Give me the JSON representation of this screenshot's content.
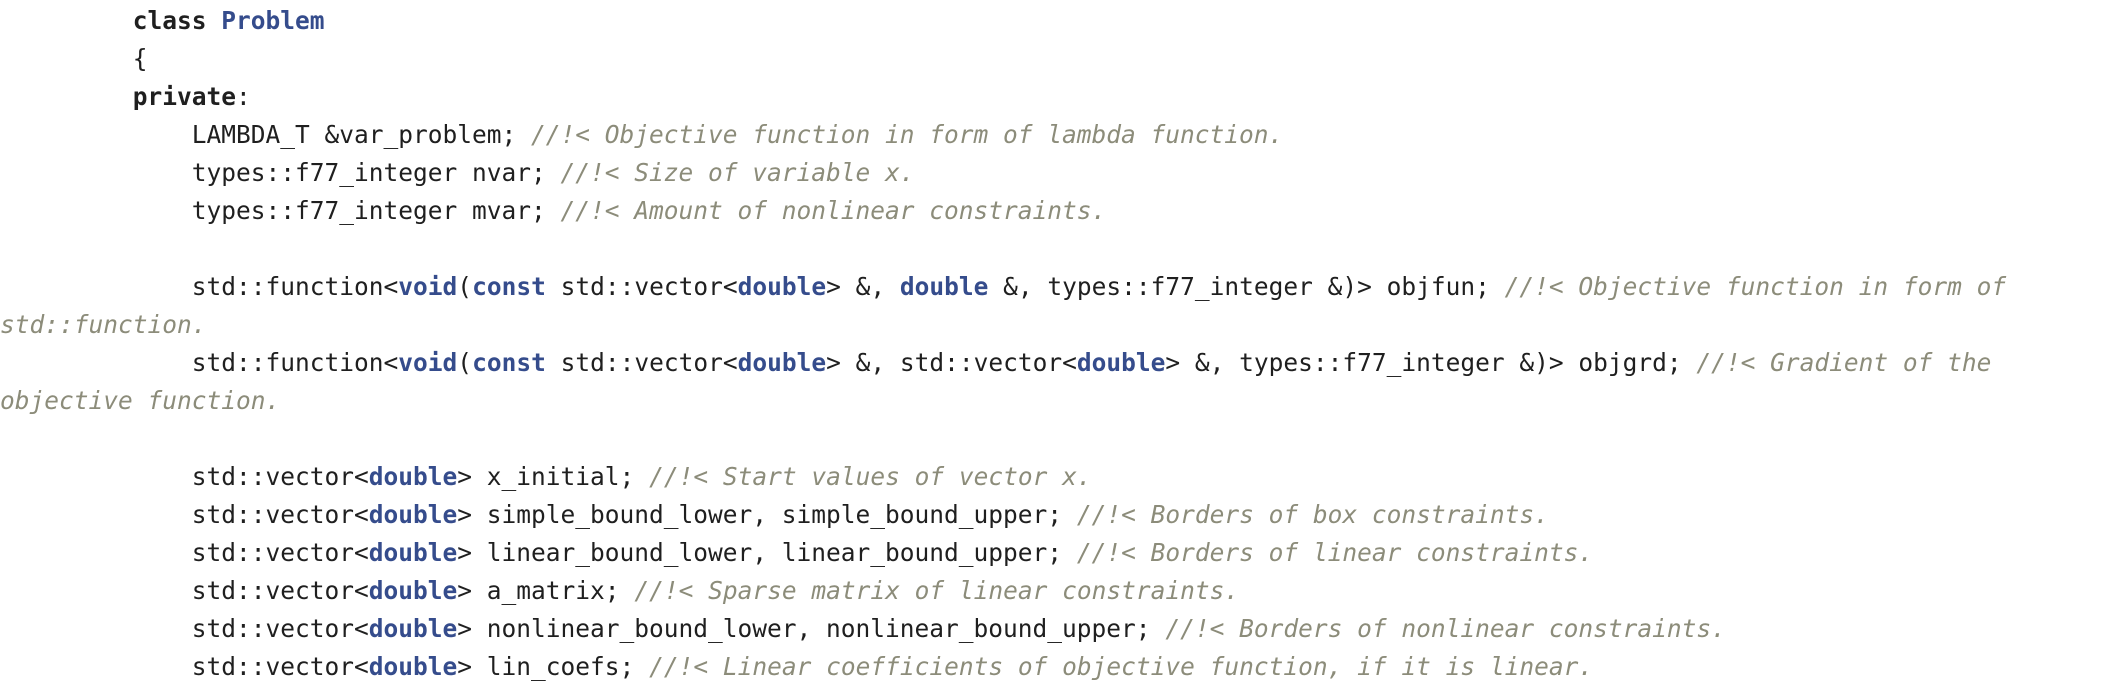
{
  "colors": {
    "background": "#ffffff",
    "text": "#1f1f1f",
    "keyword": "#1f1f1f",
    "type_keyword": "#354c8c",
    "comment": "#8c8c7a"
  },
  "code": {
    "lines": [
      {
        "indent": "         ",
        "tokens": [
          {
            "t": "class ",
            "c": "kw"
          },
          {
            "t": "Problem",
            "c": "tp"
          }
        ]
      },
      {
        "indent": "         ",
        "tokens": [
          {
            "t": "{",
            "c": "tx"
          }
        ]
      },
      {
        "indent": "         ",
        "tokens": [
          {
            "t": "private",
            "c": "kw"
          },
          {
            "t": ":",
            "c": "tx"
          }
        ]
      },
      {
        "indent": "             ",
        "tokens": [
          {
            "t": "LAMBDA_T &var_problem; ",
            "c": "tx"
          },
          {
            "t": "//!< Objective function in form of lambda function.",
            "c": "cm"
          }
        ]
      },
      {
        "indent": "             ",
        "tokens": [
          {
            "t": "types::f77_integer nvar; ",
            "c": "tx"
          },
          {
            "t": "//!< Size of variable x.",
            "c": "cm"
          }
        ]
      },
      {
        "indent": "             ",
        "tokens": [
          {
            "t": "types::f77_integer mvar; ",
            "c": "tx"
          },
          {
            "t": "//!< Amount of nonlinear constraints.",
            "c": "cm"
          }
        ]
      },
      {
        "indent": "",
        "tokens": []
      },
      {
        "indent": "             ",
        "tokens": [
          {
            "t": "std::function<",
            "c": "tx"
          },
          {
            "t": "void",
            "c": "tp"
          },
          {
            "t": "(",
            "c": "tx"
          },
          {
            "t": "const",
            "c": "tp"
          },
          {
            "t": " std::vector<",
            "c": "tx"
          },
          {
            "t": "double",
            "c": "tp"
          },
          {
            "t": "> &, ",
            "c": "tx"
          },
          {
            "t": "double",
            "c": "tp"
          },
          {
            "t": " &, types::f77_integer &)> objfun; ",
            "c": "tx"
          },
          {
            "t": "//!< Objective function in form of",
            "c": "cm"
          }
        ]
      },
      {
        "indent": "",
        "tokens": [
          {
            "t": "std::function.",
            "c": "cm"
          }
        ]
      },
      {
        "indent": "             ",
        "tokens": [
          {
            "t": "std::function<",
            "c": "tx"
          },
          {
            "t": "void",
            "c": "tp"
          },
          {
            "t": "(",
            "c": "tx"
          },
          {
            "t": "const",
            "c": "tp"
          },
          {
            "t": " std::vector<",
            "c": "tx"
          },
          {
            "t": "double",
            "c": "tp"
          },
          {
            "t": "> &, std::vector<",
            "c": "tx"
          },
          {
            "t": "double",
            "c": "tp"
          },
          {
            "t": "> &, types::f77_integer &)> objgrd; ",
            "c": "tx"
          },
          {
            "t": "//!< Gradient of the",
            "c": "cm"
          }
        ]
      },
      {
        "indent": "",
        "tokens": [
          {
            "t": "objective function.",
            "c": "cm"
          }
        ]
      },
      {
        "indent": "",
        "tokens": []
      },
      {
        "indent": "             ",
        "tokens": [
          {
            "t": "std::vector<",
            "c": "tx"
          },
          {
            "t": "double",
            "c": "tp"
          },
          {
            "t": "> x_initial; ",
            "c": "tx"
          },
          {
            "t": "//!< Start values of vector x.",
            "c": "cm"
          }
        ]
      },
      {
        "indent": "             ",
        "tokens": [
          {
            "t": "std::vector<",
            "c": "tx"
          },
          {
            "t": "double",
            "c": "tp"
          },
          {
            "t": "> simple_bound_lower, simple_bound_upper; ",
            "c": "tx"
          },
          {
            "t": "//!< Borders of box constraints.",
            "c": "cm"
          }
        ]
      },
      {
        "indent": "             ",
        "tokens": [
          {
            "t": "std::vector<",
            "c": "tx"
          },
          {
            "t": "double",
            "c": "tp"
          },
          {
            "t": "> linear_bound_lower, linear_bound_upper; ",
            "c": "tx"
          },
          {
            "t": "//!< Borders of linear constraints.",
            "c": "cm"
          }
        ]
      },
      {
        "indent": "             ",
        "tokens": [
          {
            "t": "std::vector<",
            "c": "tx"
          },
          {
            "t": "double",
            "c": "tp"
          },
          {
            "t": "> a_matrix; ",
            "c": "tx"
          },
          {
            "t": "//!< Sparse matrix of linear constraints.",
            "c": "cm"
          }
        ]
      },
      {
        "indent": "             ",
        "tokens": [
          {
            "t": "std::vector<",
            "c": "tx"
          },
          {
            "t": "double",
            "c": "tp"
          },
          {
            "t": "> nonlinear_bound_lower, nonlinear_bound_upper; ",
            "c": "tx"
          },
          {
            "t": "//!< Borders of nonlinear constraints.",
            "c": "cm"
          }
        ]
      },
      {
        "indent": "             ",
        "tokens": [
          {
            "t": "std::vector<",
            "c": "tx"
          },
          {
            "t": "double",
            "c": "tp"
          },
          {
            "t": "> lin_coefs; ",
            "c": "tx"
          },
          {
            "t": "//!< Linear coefficients of objective function, if it is linear.",
            "c": "cm"
          }
        ]
      }
    ]
  }
}
